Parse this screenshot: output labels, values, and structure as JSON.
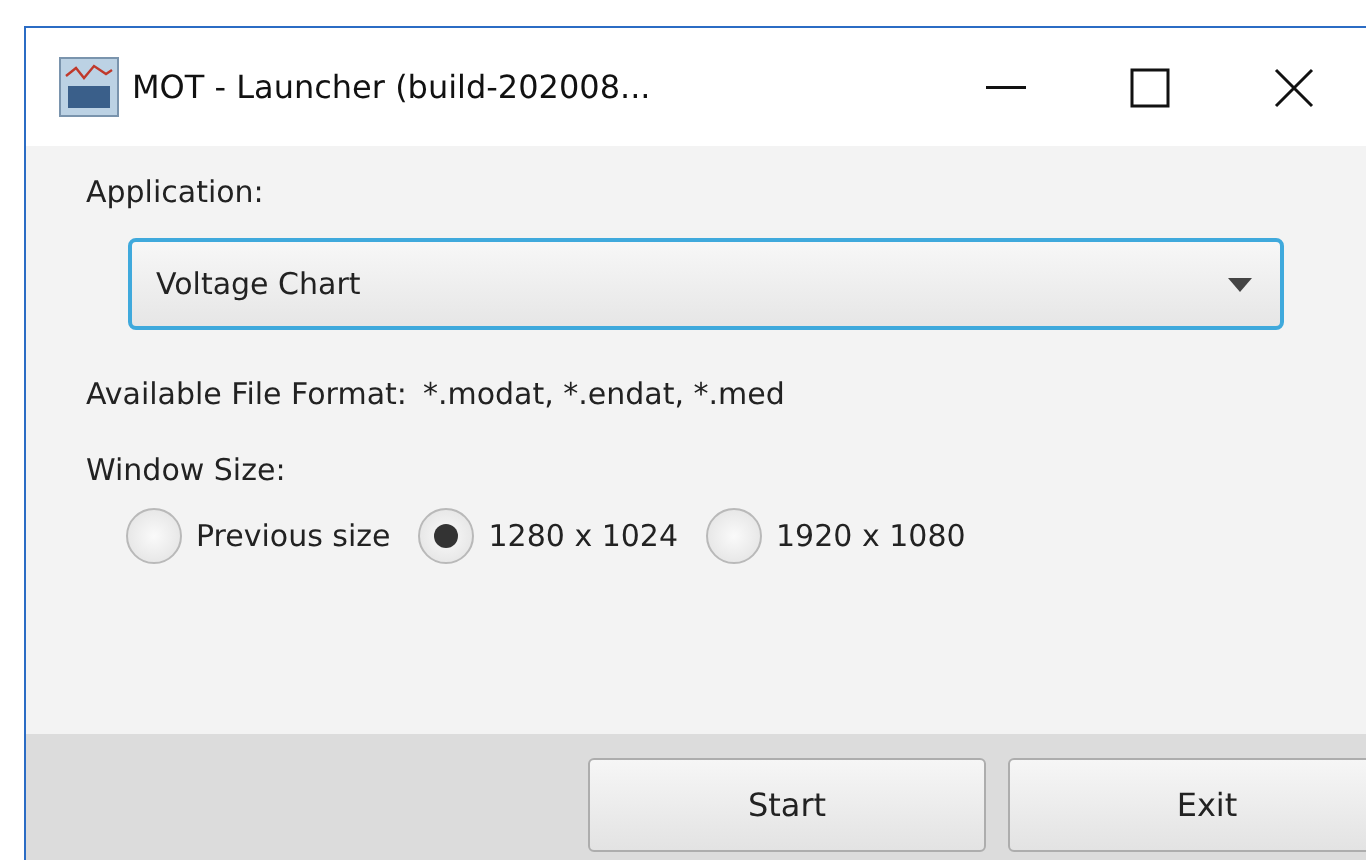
{
  "window": {
    "title": "MOT - Launcher (build-202008..."
  },
  "application": {
    "label": "Application:",
    "value": "Voltage Chart"
  },
  "file_format": {
    "label": "Available File Format:",
    "value": "*.modat, *.endat, *.med"
  },
  "window_size": {
    "label": "Window Size:",
    "options": [
      {
        "label": "Previous size",
        "selected": false
      },
      {
        "label": "1280 x 1024",
        "selected": true
      },
      {
        "label": "1920 x 1080",
        "selected": false
      }
    ]
  },
  "buttons": [
    "Start",
    "Exit"
  ]
}
